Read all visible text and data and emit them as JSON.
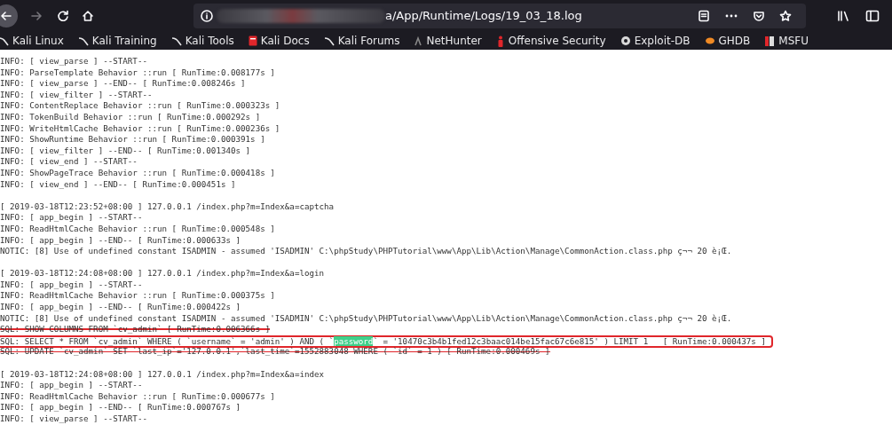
{
  "toolbar": {
    "forward_disabled": true,
    "url": "a/App/Runtime/Logs/19_03_18.log"
  },
  "bookmarks": [
    {
      "label": "Kali Linux"
    },
    {
      "label": "Kali Training"
    },
    {
      "label": "Kali Tools"
    },
    {
      "label": "Kali Docs"
    },
    {
      "label": "Kali Forums"
    },
    {
      "label": "NetHunter"
    },
    {
      "label": "Offensive Security"
    },
    {
      "label": "Exploit-DB"
    },
    {
      "label": "GHDB"
    },
    {
      "label": "MSFU"
    }
  ],
  "log_lines": [
    {
      "kind": "line",
      "text": "INFO: [ view_parse ] --START--"
    },
    {
      "kind": "line",
      "text": "INFO: ParseTemplate Behavior ::run [ RunTime:0.008177s ]"
    },
    {
      "kind": "line",
      "text": "INFO: [ view_parse ] --END-- [ RunTime:0.008246s ]"
    },
    {
      "kind": "line",
      "text": "INFO: [ view_filter ] --START--"
    },
    {
      "kind": "line",
      "text": "INFO: ContentReplace Behavior ::run [ RunTime:0.000323s ]"
    },
    {
      "kind": "line",
      "text": "INFO: TokenBuild Behavior ::run [ RunTime:0.000292s ]"
    },
    {
      "kind": "line",
      "text": "INFO: WriteHtmlCache Behavior ::run [ RunTime:0.000236s ]"
    },
    {
      "kind": "line",
      "text": "INFO: ShowRuntime Behavior ::run [ RunTime:0.000391s ]"
    },
    {
      "kind": "line",
      "text": "INFO: [ view_filter ] --END-- [ RunTime:0.001340s ]"
    },
    {
      "kind": "line",
      "text": "INFO: [ view_end ] --START--"
    },
    {
      "kind": "line",
      "text": "INFO: ShowPageTrace Behavior ::run [ RunTime:0.000418s ]"
    },
    {
      "kind": "line",
      "text": "INFO: [ view_end ] --END-- [ RunTime:0.000451s ]"
    },
    {
      "kind": "blank"
    },
    {
      "kind": "line",
      "text": "[ 2019-03-18T12:23:52+08:00 ] 127.0.0.1 /index.php?m=Index&a=captcha"
    },
    {
      "kind": "line",
      "text": "INFO: [ app_begin ] --START--"
    },
    {
      "kind": "line",
      "text": "INFO: ReadHtmlCache Behavior ::run [ RunTime:0.000548s ]"
    },
    {
      "kind": "line",
      "text": "INFO: [ app_begin ] --END-- [ RunTime:0.000633s ]"
    },
    {
      "kind": "line",
      "text": "NOTIC: [8] Use of undefined constant ISADMIN - assumed 'ISADMIN' C:\\phpStudy\\PHPTutorial\\www\\App\\Lib\\Action\\Manage\\CommonAction.class.php ç¬¬ 20 è¡Œ."
    },
    {
      "kind": "blank"
    },
    {
      "kind": "line",
      "text": "[ 2019-03-18T12:24:08+08:00 ] 127.0.0.1 /index.php?m=Index&a=login"
    },
    {
      "kind": "line",
      "text": "INFO: [ app_begin ] --START--"
    },
    {
      "kind": "line",
      "text": "INFO: ReadHtmlCache Behavior ::run [ RunTime:0.000375s ]"
    },
    {
      "kind": "line",
      "text": "INFO: [ app_begin ] --END-- [ RunTime:0.000422s ]"
    },
    {
      "kind": "line",
      "text": "NOTIC: [8] Use of undefined constant ISADMIN - assumed 'ISADMIN' C:\\phpStudy\\PHPTutorial\\www\\App\\Lib\\Action\\Manage\\CommonAction.class.php ç¬¬ 20 è¡Œ."
    },
    {
      "kind": "struck",
      "text": "SQL: SHOW COLUMNS FROM `cv_admin` [ RunTime:0.006366s ]"
    },
    {
      "kind": "boxed",
      "segments": [
        {
          "text": "SQL: SELECT * FROM `cv_admin` WHERE ( `username` = 'admin' ) AND ( `",
          "highlighted": false
        },
        {
          "text": "password",
          "highlighted": true
        },
        {
          "text": "` = '10470c3b4b1fed12c3baac014be15fac67c6e815' ) LIMIT 1   [ RunTime:0.000437s ]",
          "highlighted": false
        }
      ]
    },
    {
      "kind": "struck",
      "text": "SQL: UPDATE `cv_admin` SET `last_ip`='127.0.0.1',`last_time`=1552883048 WHERE ( `id` = 1 ) [ RunTime:0.000469s ]"
    },
    {
      "kind": "blank"
    },
    {
      "kind": "line",
      "text": "[ 2019-03-18T12:24:08+08:00 ] 127.0.0.1 /index.php?m=Index&a=index"
    },
    {
      "kind": "line",
      "text": "INFO: [ app_begin ] --START--"
    },
    {
      "kind": "line",
      "text": "INFO: ReadHtmlCache Behavior ::run [ RunTime:0.000677s ]"
    },
    {
      "kind": "line",
      "text": "INFO: [ app_begin ] --END-- [ RunTime:0.000767s ]"
    },
    {
      "kind": "line",
      "text": "INFO: [ view_parse ] --START--"
    }
  ]
}
